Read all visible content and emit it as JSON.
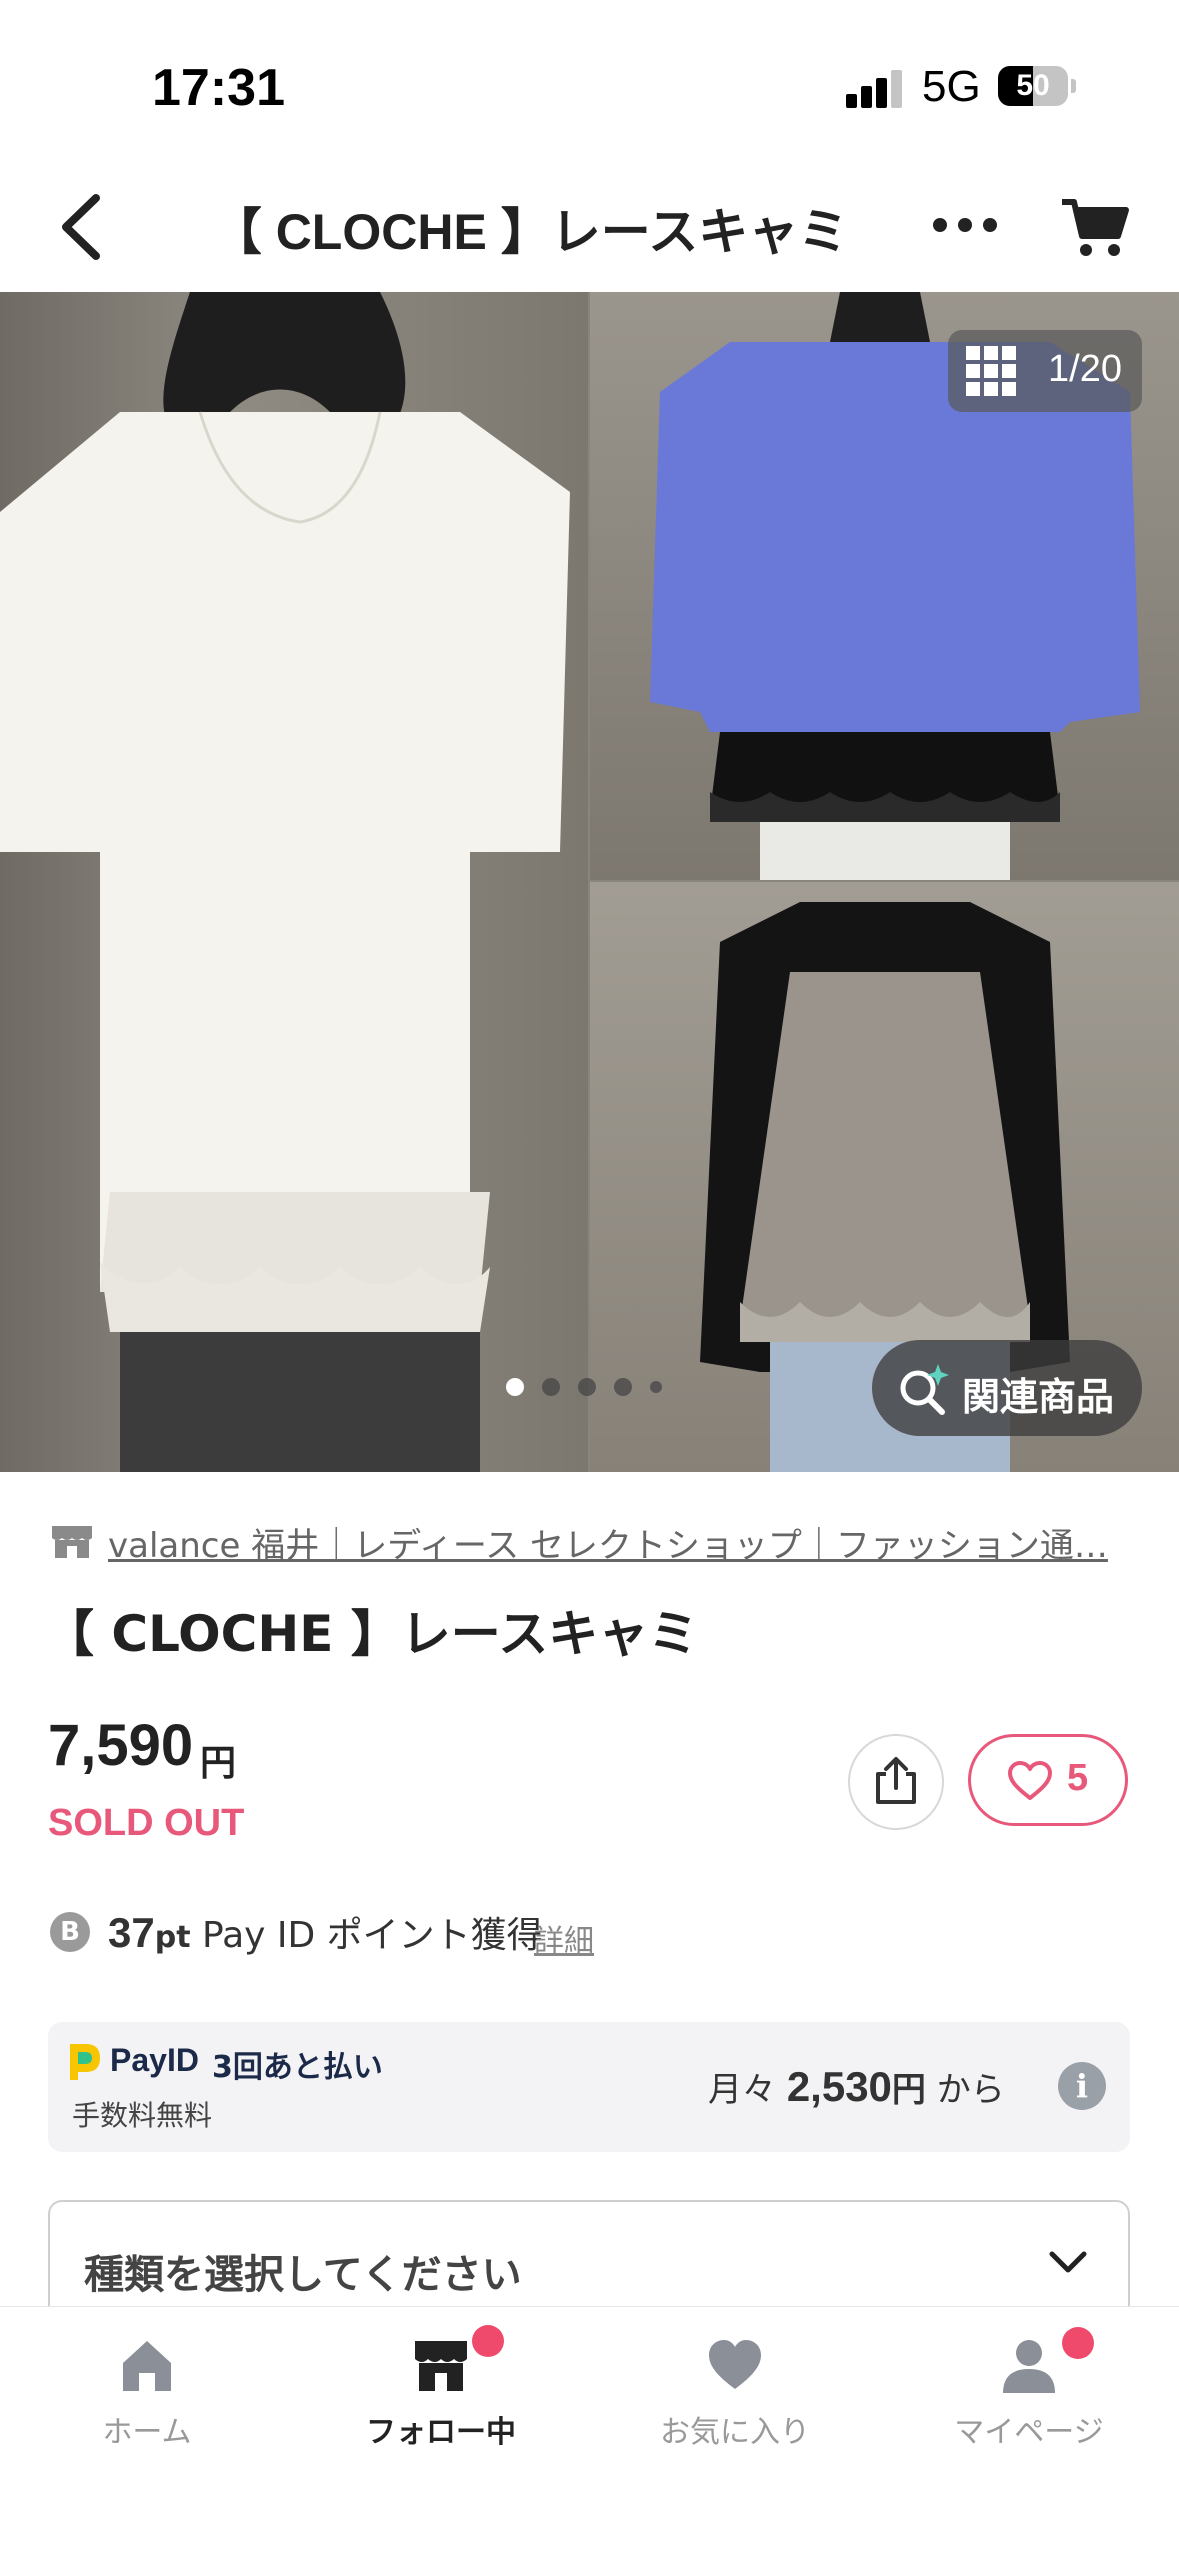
{
  "status_bar": {
    "time": "17:31",
    "network": "5G",
    "battery": "50",
    "battery_level": 0.5
  },
  "header": {
    "title": "【 CLOCHE 】レースキャミ"
  },
  "gallery": {
    "counter": "1/20",
    "dots_count": 5,
    "active_dot": 0,
    "related_label": "関連商品"
  },
  "product": {
    "shop_name": "valance 福井｜レディース セレクトショップ｜ファッション通…",
    "name": "【 CLOCHE 】レースキャミ",
    "price": "7,590",
    "currency": "円",
    "status": "SOLD OUT",
    "like_count": "5"
  },
  "points": {
    "icon": "B",
    "amount": "37",
    "unit": "pt",
    "text": "Pay ID ポイント獲得",
    "detail_link": "詳細"
  },
  "payid": {
    "brand": "PayID",
    "plan": "3回あと払い",
    "fee": "手数料無料",
    "monthly_prefix": "月々",
    "monthly_amount": "2,530",
    "monthly_unit": "円",
    "monthly_suffix": "から"
  },
  "variant_select": {
    "placeholder": "種類を選択してください"
  },
  "tabbar": {
    "items": [
      {
        "label": "ホーム",
        "icon": "home-icon",
        "active": false,
        "badge": false
      },
      {
        "label": "フォロー中",
        "icon": "shop-icon",
        "active": true,
        "badge": true
      },
      {
        "label": "お気に入り",
        "icon": "heart-icon",
        "active": false,
        "badge": false
      },
      {
        "label": "マイページ",
        "icon": "person-icon",
        "active": false,
        "badge": true
      }
    ]
  },
  "colors": {
    "accent": "#e8587a",
    "badge": "#ef4a6c",
    "text": "#222222",
    "muted": "#999999"
  }
}
